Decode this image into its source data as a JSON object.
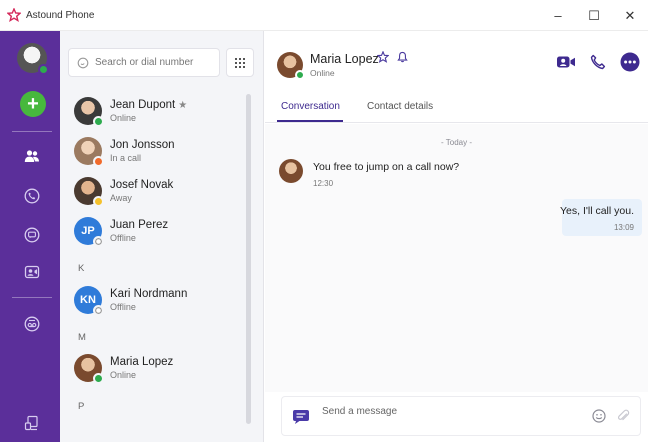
{
  "window": {
    "title": "Astound Phone",
    "minimize": "–",
    "maximize": "☐",
    "close": "✕"
  },
  "rail": {
    "add_label": "+"
  },
  "search": {
    "placeholder": "Search or dial number"
  },
  "contacts": [
    {
      "name": "Jean Dupont",
      "status": "Online",
      "favorite": true,
      "status_color": "#2dab4e"
    },
    {
      "name": "Jon Jonsson",
      "status": "In a call",
      "status_color": "#f16a2a"
    },
    {
      "name": "Josef Novak",
      "status": "Away",
      "status_color": "#f5c12b"
    },
    {
      "name": "Juan Perez",
      "status": "Offline",
      "initials": "JP",
      "avatar_color": "#2f7bd9",
      "status_color": "#ffffff"
    },
    {
      "name": "Kari Nordmann",
      "status": "Offline",
      "initials": "KN",
      "avatar_color": "#2f7bd9",
      "status_color": "#ffffff"
    },
    {
      "name": "Maria Lopez",
      "status": "Online",
      "status_color": "#2dab4e"
    }
  ],
  "sections": [
    "K",
    "M",
    "P"
  ],
  "header": {
    "name": "Maria Lopez",
    "status": "Online"
  },
  "tabs": [
    {
      "label": "Conversation",
      "active": true
    },
    {
      "label": "Contact details",
      "active": false
    }
  ],
  "conversation": {
    "day_separator": "- Today -",
    "incoming": {
      "text": "You free to jump on a call now?",
      "time": "12:30"
    },
    "outgoing": {
      "text": "Yes, I'll call you.",
      "time": "13:09"
    }
  },
  "composer": {
    "placeholder": "Send a message"
  },
  "colors": {
    "rail": "#5b2f9a",
    "accent": "#3e2a8f",
    "online": "#2dab4e",
    "in_call": "#f16a2a",
    "away": "#f5c12b"
  }
}
